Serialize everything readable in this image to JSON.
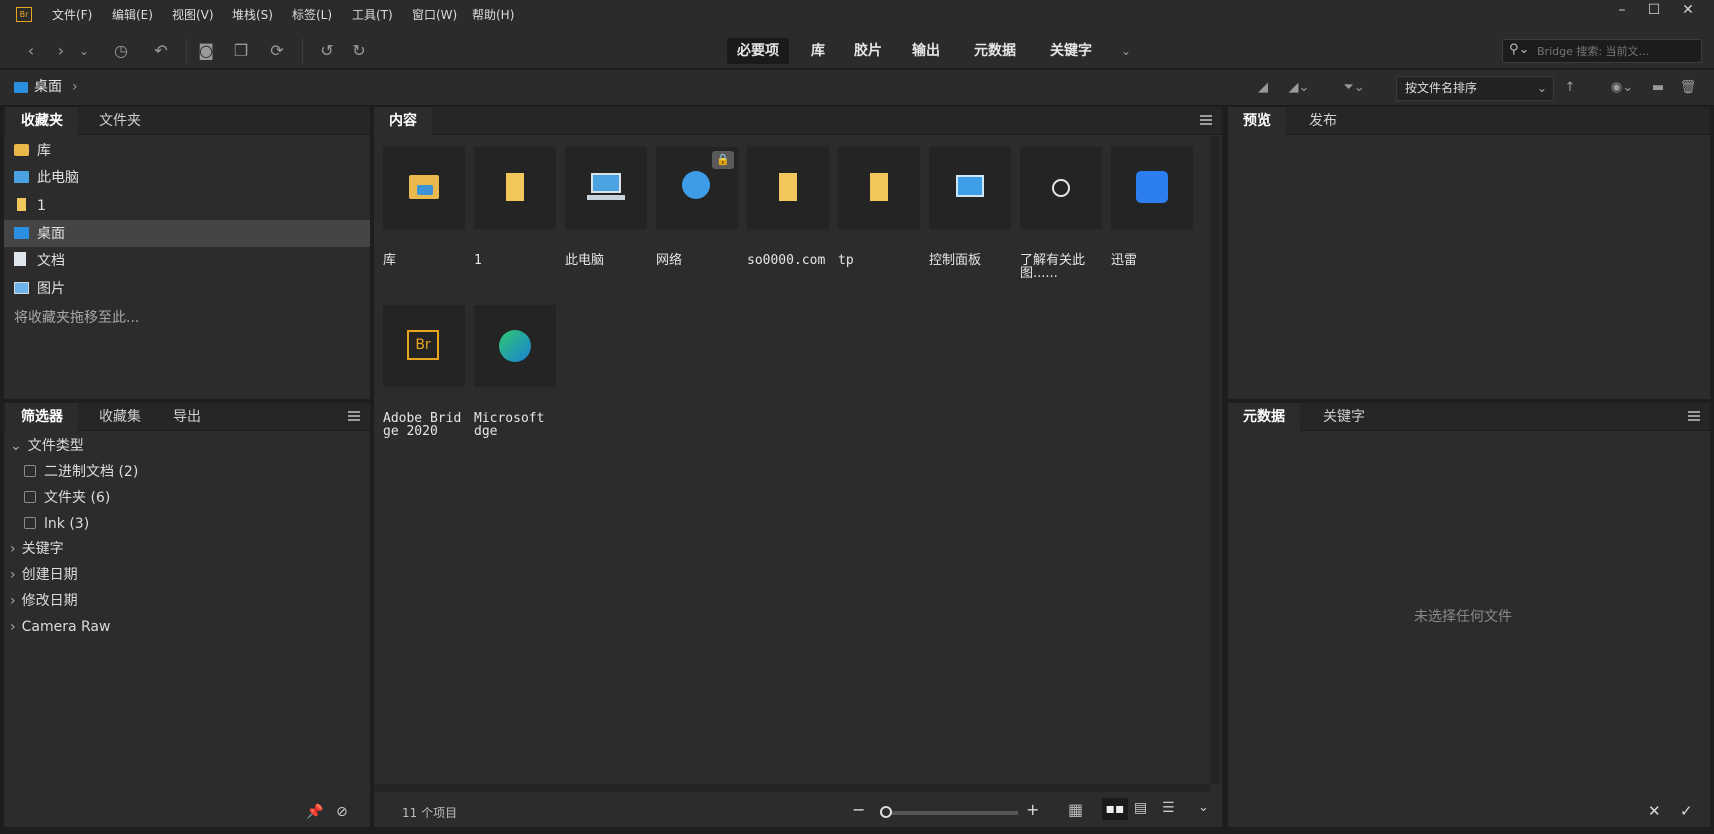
{
  "app": {
    "logo": "Br"
  },
  "menu": [
    "文件(F)",
    "编辑(E)",
    "视图(V)",
    "堆栈(S)",
    "标签(L)",
    "工具(T)",
    "窗口(W)",
    "帮助(H)"
  ],
  "window_controls": {
    "minimize": "–",
    "maximize": "☐",
    "close": "✕"
  },
  "workspaces": [
    "必要项",
    "库",
    "胶片",
    "输出",
    "元数据",
    "关键字"
  ],
  "search": {
    "placeholder": "Bridge 搜索: 当前文..."
  },
  "path": {
    "current": "桌面",
    "arrow": "›"
  },
  "sort": {
    "label": "按文件名排序",
    "arrow": "⌄"
  },
  "left_top": {
    "tabs": [
      "收藏夹",
      "文件夹"
    ],
    "items": [
      {
        "label": "库",
        "icon": "library-icon"
      },
      {
        "label": "此电脑",
        "icon": "computer-icon"
      },
      {
        "label": "1",
        "icon": "folder-icon"
      },
      {
        "label": "桌面",
        "icon": "desktop-icon"
      },
      {
        "label": "文档",
        "icon": "document-icon"
      },
      {
        "label": "图片",
        "icon": "picture-icon"
      }
    ],
    "hint": "将收藏夹拖移至此..."
  },
  "left_bottom": {
    "tabs": [
      "筛选器",
      "收藏集",
      "导出"
    ],
    "group": "文件类型",
    "checks": [
      {
        "label": "二进制文档 (2)"
      },
      {
        "label": "文件夹 (6)"
      },
      {
        "label": "lnk (3)"
      }
    ],
    "collapsed": [
      "关键字",
      "创建日期",
      "修改日期",
      "Camera Raw"
    ]
  },
  "content": {
    "tab": "内容",
    "items": [
      {
        "label": "库",
        "icon": "library-icon"
      },
      {
        "label": "1",
        "icon": "folder-icon"
      },
      {
        "label": "此电脑",
        "icon": "computer-icon"
      },
      {
        "label": "网络",
        "icon": "network-icon"
      },
      {
        "label": "so0000.com",
        "icon": "folder-icon"
      },
      {
        "label": "tp",
        "icon": "folder-icon"
      },
      {
        "label": "控制面板",
        "icon": "control-panel-icon"
      },
      {
        "label": "了解有关此图......",
        "icon": "info-icon"
      },
      {
        "label": "迅雷",
        "icon": "thunder-icon"
      },
      {
        "label": "Adobe Bridge 2020",
        "icon": "bridge-icon"
      },
      {
        "label": "Microsoft dge",
        "icon": "edge-icon"
      }
    ],
    "status": "11 个项目"
  },
  "right_top": {
    "tabs": [
      "预览",
      "发布"
    ]
  },
  "right_bottom": {
    "tabs": [
      "元数据",
      "关键字"
    ],
    "empty": "未选择任何文件"
  },
  "colors": {
    "accent": "#e8a51c",
    "panel": "#2c2c2c",
    "tabbar": "#262626"
  }
}
